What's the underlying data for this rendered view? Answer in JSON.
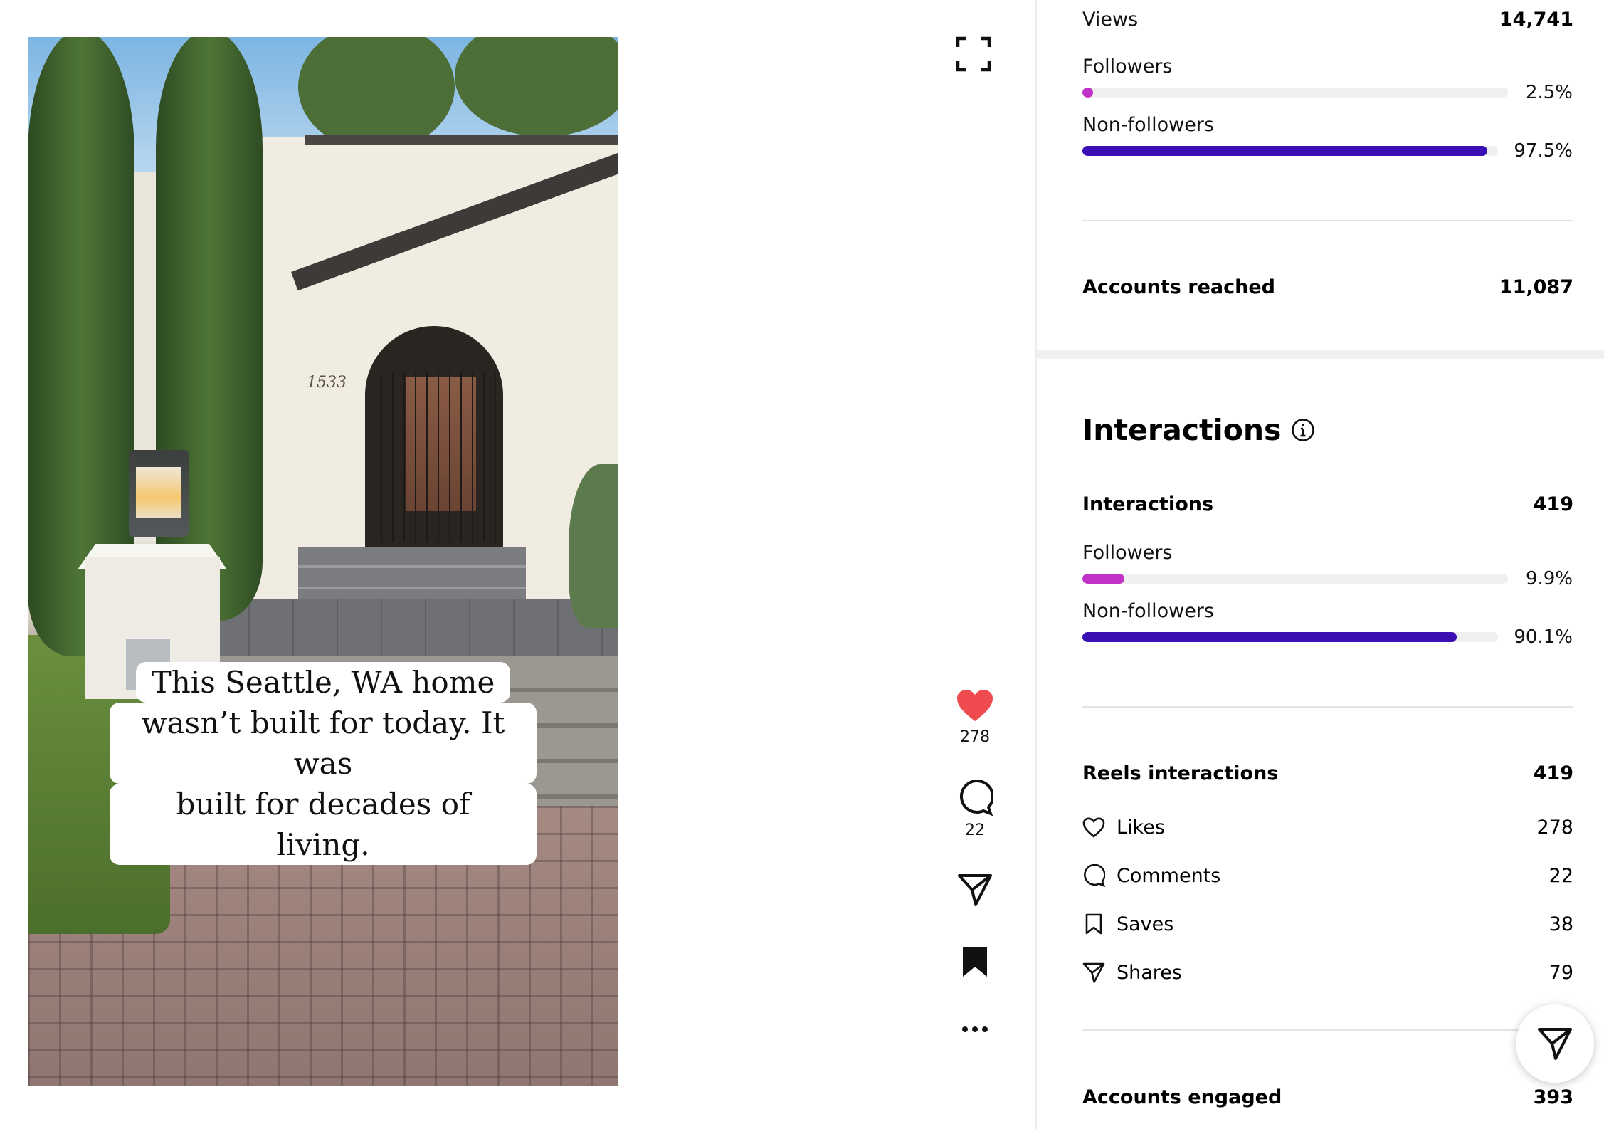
{
  "video": {
    "house_number": "1533",
    "caption_lines": [
      "This Seattle, WA home",
      "wasn’t built for today. It was",
      "built for decades of living."
    ]
  },
  "actions": {
    "likes_count": "278",
    "comments_count": "22"
  },
  "views": {
    "label": "Views",
    "value": "14,741",
    "followers_label": "Followers",
    "followers_pct": "2.5%",
    "followers_fraction": 0.025,
    "nonfollowers_label": "Non-followers",
    "nonfollowers_pct": "97.5%",
    "nonfollowers_fraction": 0.975
  },
  "reach": {
    "label": "Accounts reached",
    "value": "11,087"
  },
  "interactions": {
    "title": "Interactions",
    "label": "Interactions",
    "value": "419",
    "followers_label": "Followers",
    "followers_pct": "9.9%",
    "followers_fraction": 0.099,
    "nonfollowers_label": "Non-followers",
    "nonfollowers_pct": "90.1%",
    "nonfollowers_fraction": 0.901
  },
  "reels": {
    "label": "Reels interactions",
    "value": "419",
    "items": [
      {
        "icon": "heart-outline-icon",
        "label": "Likes",
        "value": "278"
      },
      {
        "icon": "comment-outline-icon",
        "label": "Comments",
        "value": "22"
      },
      {
        "icon": "bookmark-outline-icon",
        "label": "Saves",
        "value": "38"
      },
      {
        "icon": "send-outline-icon",
        "label": "Shares",
        "value": "79"
      }
    ]
  },
  "engaged": {
    "label": "Accounts engaged",
    "value": "393"
  },
  "colors": {
    "followers_bar": "#c132c9",
    "nonfollowers_bar": "#3a10b5",
    "like_heart": "#ef4a4e",
    "track": "#efefef"
  }
}
